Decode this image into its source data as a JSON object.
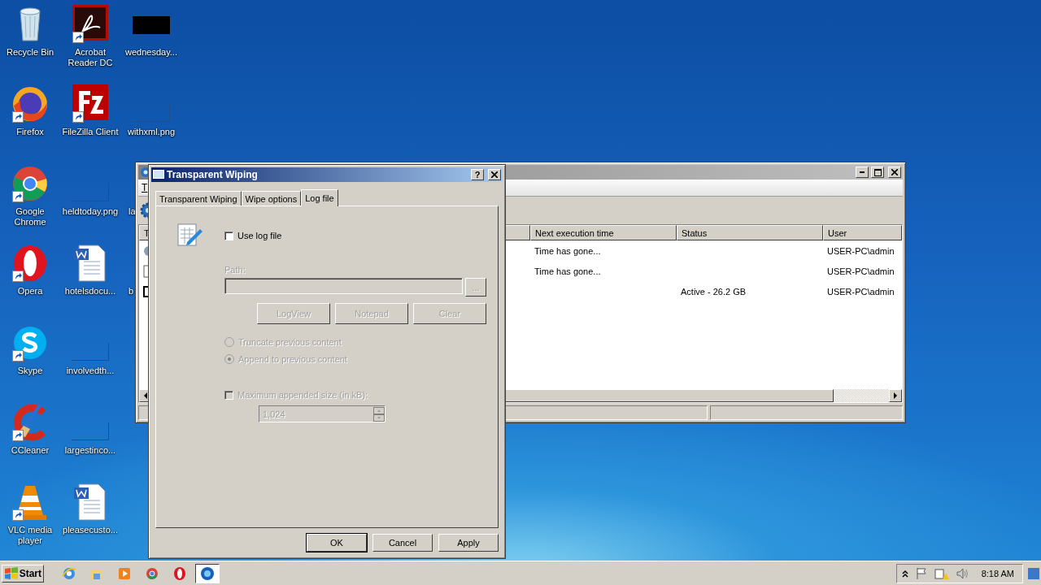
{
  "desktop": {
    "columns": [
      [
        {
          "label": "Recycle Bin",
          "kind": "recycle-bin",
          "shortcut": false
        },
        {
          "label": "Firefox",
          "kind": "firefox",
          "shortcut": true
        },
        {
          "label": "Google\nChrome",
          "kind": "chrome",
          "shortcut": true
        },
        {
          "label": "Opera",
          "kind": "opera",
          "shortcut": true
        },
        {
          "label": "Skype",
          "kind": "skype",
          "shortcut": true
        },
        {
          "label": "CCleaner",
          "kind": "ccleaner",
          "shortcut": true
        },
        {
          "label": "VLC media\nplayer",
          "kind": "vlc",
          "shortcut": true
        }
      ],
      [
        {
          "label": "Acrobat\nReader DC",
          "kind": "acrobat",
          "shortcut": true
        },
        {
          "label": "FileZilla Client",
          "kind": "filezilla",
          "shortcut": true
        },
        {
          "label": "heldtoday.png",
          "kind": "blank-image",
          "shortcut": false
        },
        {
          "label": "hotelsdocu...",
          "kind": "word",
          "shortcut": false
        },
        {
          "label": "involvedth...",
          "kind": "blank-image",
          "shortcut": false
        },
        {
          "label": "largestinco...",
          "kind": "blank-image",
          "shortcut": false
        },
        {
          "label": "pleasecusto...",
          "kind": "word",
          "shortcut": false
        }
      ],
      [
        {
          "label": "wednesday...",
          "kind": "black-image",
          "shortcut": false
        },
        {
          "label": "withxml.png",
          "kind": "blank-image",
          "shortcut": false
        },
        {
          "label": "la",
          "kind": "covered"
        },
        {
          "label": "b",
          "kind": "covered"
        }
      ]
    ]
  },
  "main_window": {
    "menu": [
      "T"
    ],
    "columns": [
      "T",
      "Next execution time",
      "Status",
      "User"
    ],
    "rows": [
      {
        "kind": "globe",
        "cells": [
          "",
          "Time has gone...",
          "",
          "USER-PC\\admin"
        ]
      },
      {
        "kind": "frame",
        "cells": [
          "",
          "Time has gone...",
          "",
          "USER-PC\\admin"
        ]
      },
      {
        "kind": "square",
        "cells": [
          "",
          "",
          "Active - 26.2 GB",
          "USER-PC\\admin"
        ]
      }
    ]
  },
  "dialog": {
    "title": "Transparent Wiping",
    "help": "?",
    "tabs": [
      {
        "label": "Transparent Wiping",
        "selected": false
      },
      {
        "label": "Wipe options",
        "selected": false
      },
      {
        "label": "Log file",
        "selected": true
      }
    ],
    "use_log": {
      "label": "Use log file",
      "checked": false
    },
    "path": {
      "label": "Path:",
      "disabled": true,
      "browse": "..."
    },
    "log_buttons": [
      {
        "label": "LogView",
        "disabled": true
      },
      {
        "label": "Notepad",
        "disabled": true
      },
      {
        "label": "Clear",
        "disabled": true
      }
    ],
    "mode": [
      {
        "label": "Truncate previous content",
        "selected": false,
        "disabled": true
      },
      {
        "label": "Append to previous content",
        "selected": true,
        "disabled": true
      }
    ],
    "max_size": {
      "label": "Maximum appended size (in kB):",
      "checked": false,
      "disabled": true,
      "value": "1,024"
    },
    "buttons": [
      {
        "label": "OK",
        "default": true
      },
      {
        "label": "Cancel",
        "default": false
      },
      {
        "label": "Apply",
        "default": false
      }
    ]
  },
  "taskbar": {
    "start": "Start",
    "apps": [
      {
        "kind": "ie",
        "selected": false
      },
      {
        "kind": "explorer",
        "selected": false
      },
      {
        "kind": "media",
        "selected": false
      },
      {
        "kind": "chrome",
        "selected": false
      },
      {
        "kind": "opera",
        "selected": false
      },
      {
        "kind": "globe",
        "selected": true
      }
    ],
    "clock": "8:18 AM"
  }
}
